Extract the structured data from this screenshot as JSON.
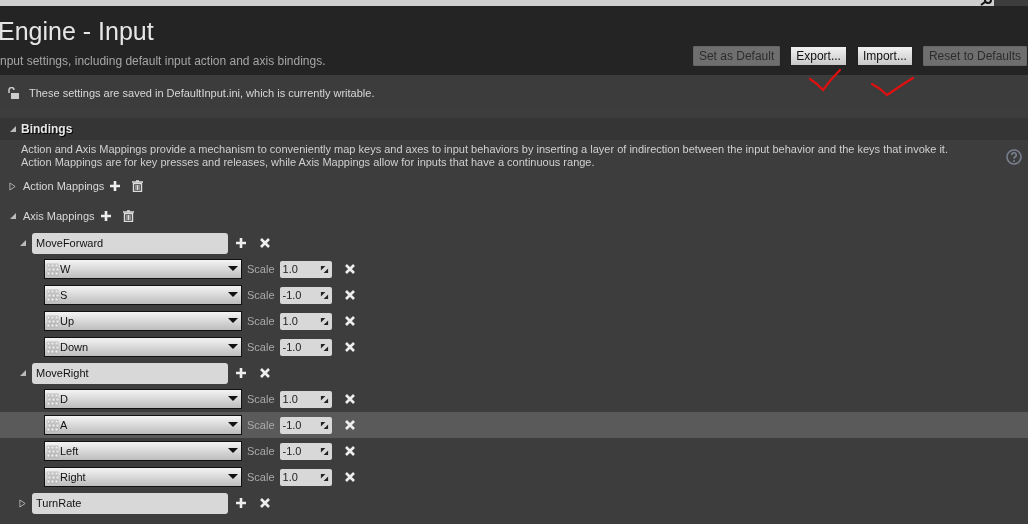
{
  "title": "Engine - Input",
  "subtitle": "nput settings, including default input action and axis bindings.",
  "buttons": [
    {
      "label": "Set as Default",
      "disabled": true
    },
    {
      "label": "Export...",
      "disabled": false
    },
    {
      "label": "Import...",
      "disabled": false
    },
    {
      "label": "Reset to Defaults",
      "disabled": true
    }
  ],
  "notice": "These settings are saved in DefaultInput.ini, which is currently writable.",
  "section": {
    "title": "Bindings",
    "expanded": true,
    "description": [
      "Action and Axis Mappings provide a mechanism to conveniently map keys and axes to input behaviors by inserting a layer of indirection between the input behavior and the keys that invoke it.",
      "Action Mappings are for key presses and releases, while Axis Mappings allow for inputs that have a continuous range."
    ],
    "groups": [
      {
        "label": "Action Mappings",
        "expanded": false
      },
      {
        "label": "Axis Mappings",
        "expanded": true,
        "children": [
          {
            "name": "MoveForward",
            "expanded": true,
            "children": [
              {
                "key": "W",
                "scale_label": "Scale",
                "scale": "1.0",
                "highlighted": false
              },
              {
                "key": "S",
                "scale_label": "Scale",
                "scale": "-1.0",
                "highlighted": false
              },
              {
                "key": "Up",
                "scale_label": "Scale",
                "scale": "1.0",
                "highlighted": false
              },
              {
                "key": "Down",
                "scale_label": "Scale",
                "scale": "-1.0",
                "highlighted": false
              }
            ]
          },
          {
            "name": "MoveRight",
            "expanded": true,
            "children": [
              {
                "key": "D",
                "scale_label": "Scale",
                "scale": "1.0",
                "highlighted": false
              },
              {
                "key": "A",
                "scale_label": "Scale",
                "scale": "-1.0",
                "highlighted": true
              },
              {
                "key": "Left",
                "scale_label": "Scale",
                "scale": "-1.0",
                "highlighted": false
              },
              {
                "key": "Right",
                "scale_label": "Scale",
                "scale": "1.0",
                "highlighted": false
              }
            ]
          },
          {
            "name": "TurnRate",
            "expanded": false
          }
        ]
      }
    ]
  }
}
